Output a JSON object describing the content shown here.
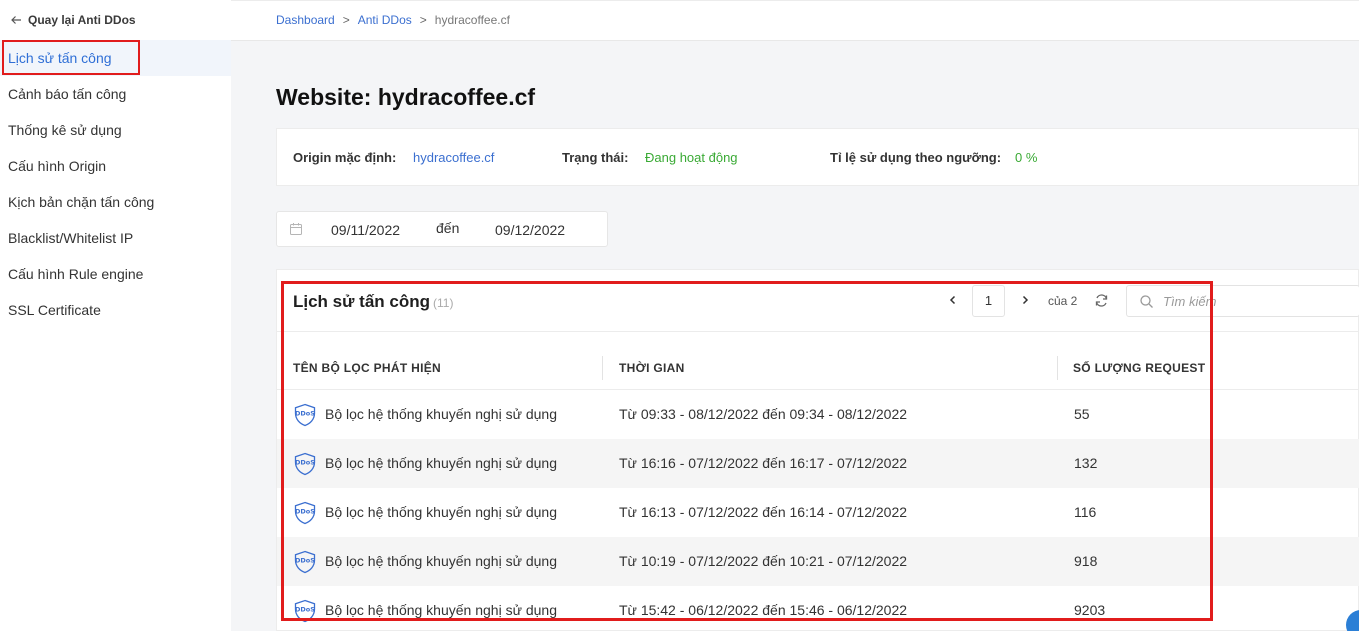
{
  "sidebar": {
    "back_label": "Quay lại Anti DDos",
    "items": [
      {
        "label": "Lịch sử tấn công"
      },
      {
        "label": "Cảnh báo tấn công"
      },
      {
        "label": "Thống kê sử dụng"
      },
      {
        "label": "Cấu hình Origin"
      },
      {
        "label": "Kịch bản chặn tấn công"
      },
      {
        "label": "Blacklist/Whitelist IP"
      },
      {
        "label": "Cấu hình Rule engine"
      },
      {
        "label": "SSL Certificate"
      }
    ]
  },
  "breadcrumb": {
    "items": [
      "Dashboard",
      "Anti DDos",
      "hydracoffee.cf"
    ],
    "separator": ">"
  },
  "page": {
    "title": "Website: hydracoffee.cf"
  },
  "info": {
    "origin_label": "Origin mặc định:",
    "origin_value": "hydracoffee.cf",
    "status_label": "Trạng thái:",
    "status_value": "Đang hoạt động",
    "ratio_label": "Tỉ lệ sử dụng theo ngưỡng:",
    "ratio_value": "0 %"
  },
  "date_range": {
    "from": "09/11/2022",
    "to_word": "đến",
    "to": "09/12/2022"
  },
  "panel": {
    "title": "Lịch sử tấn công",
    "count": "(11)",
    "pager": {
      "current": "1",
      "of_label": "của 2"
    },
    "search_placeholder": "Tìm kiếm",
    "columns": [
      "TÊN BỘ LỌC PHÁT HIỆN",
      "THỜI GIAN",
      "SỐ LƯỢNG REQUEST"
    ],
    "rows": [
      {
        "filter": "Bộ lọc hệ thống khuyến nghị sử dụng",
        "time": "Từ 09:33 - 08/12/2022 đến 09:34 - 08/12/2022",
        "requests": "55"
      },
      {
        "filter": "Bộ lọc hệ thống khuyến nghị sử dụng",
        "time": "Từ 16:16 - 07/12/2022 đến 16:17 - 07/12/2022",
        "requests": "132"
      },
      {
        "filter": "Bộ lọc hệ thống khuyến nghị sử dụng",
        "time": "Từ 16:13 - 07/12/2022 đến 16:14 - 07/12/2022",
        "requests": "116"
      },
      {
        "filter": "Bộ lọc hệ thống khuyến nghị sử dụng",
        "time": "Từ 10:19 - 07/12/2022 đến 10:21 - 07/12/2022",
        "requests": "918"
      },
      {
        "filter": "Bộ lọc hệ thống khuyến nghị sử dụng",
        "time": "Từ 15:42 - 06/12/2022 đến 15:46 - 06/12/2022",
        "requests": "9203"
      }
    ]
  },
  "colors": {
    "accent_blue": "#3b6fd0",
    "status_green": "#3aaa35",
    "highlight_red": "#e11c1c"
  },
  "icons": {
    "back": "arrow-left-icon",
    "calendar": "calendar-icon",
    "prev": "chevron-left-icon",
    "next": "chevron-right-icon",
    "refresh": "refresh-icon",
    "search": "search-icon",
    "ddos": "ddos-shield-icon"
  }
}
